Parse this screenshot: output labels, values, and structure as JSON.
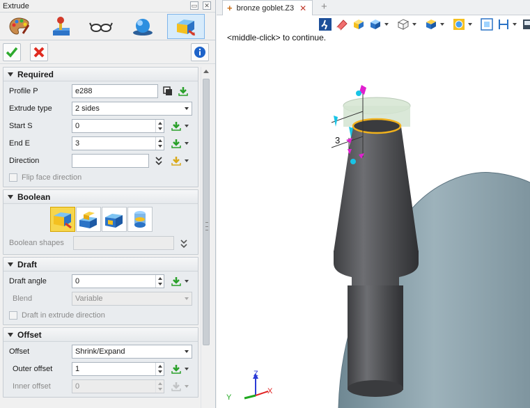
{
  "panel": {
    "title": "Extrude",
    "toolbar_icons": [
      "paint-palette-icon",
      "joystick-icon",
      "glasses-icon",
      "sphere-icon",
      "extrude-icon"
    ],
    "actions": {
      "ok_icon": "checkmark-icon",
      "cancel_icon": "x-icon",
      "info_icon": "info-icon"
    }
  },
  "required": {
    "header": "Required",
    "profile": {
      "label": "Profile P",
      "value": "e288"
    },
    "extrude_type": {
      "label": "Extrude type",
      "value": "2 sides"
    },
    "start": {
      "label": "Start S",
      "value": "0"
    },
    "end": {
      "label": "End E",
      "value": "3"
    },
    "direction": {
      "label": "Direction",
      "value": ""
    },
    "flip": {
      "label": "Flip face direction"
    }
  },
  "boolean": {
    "header": "Boolean",
    "ops": [
      "base-icon",
      "add-icon",
      "remove-icon",
      "intersect-icon"
    ],
    "shapes_label": "Boolean shapes"
  },
  "draft": {
    "header": "Draft",
    "angle": {
      "label": "Draft angle",
      "value": "0"
    },
    "blend": {
      "label": "Blend",
      "value": "Variable"
    },
    "in_dir": {
      "label": "Draft in extrude direction"
    }
  },
  "offset": {
    "header": "Offset",
    "type": {
      "label": "Offset",
      "value": "Shrink/Expand"
    },
    "outer": {
      "label": "Outer offset",
      "value": "1"
    },
    "inner": {
      "label": "Inner offset",
      "value": "0"
    }
  },
  "viewport": {
    "tab_name": "bronze goblet.Z3",
    "tab_close": "✕",
    "new_tab": "+",
    "hint": "<middle-click> to continue.",
    "dim_label": "3",
    "axes": {
      "x": "X",
      "y": "Y",
      "z": "Z"
    },
    "colors": {
      "accent": "#f5a623",
      "magenta": "#e020d0",
      "cyan": "#18c4e6",
      "body": "#55565a",
      "surface": "#8fa5b0"
    }
  }
}
